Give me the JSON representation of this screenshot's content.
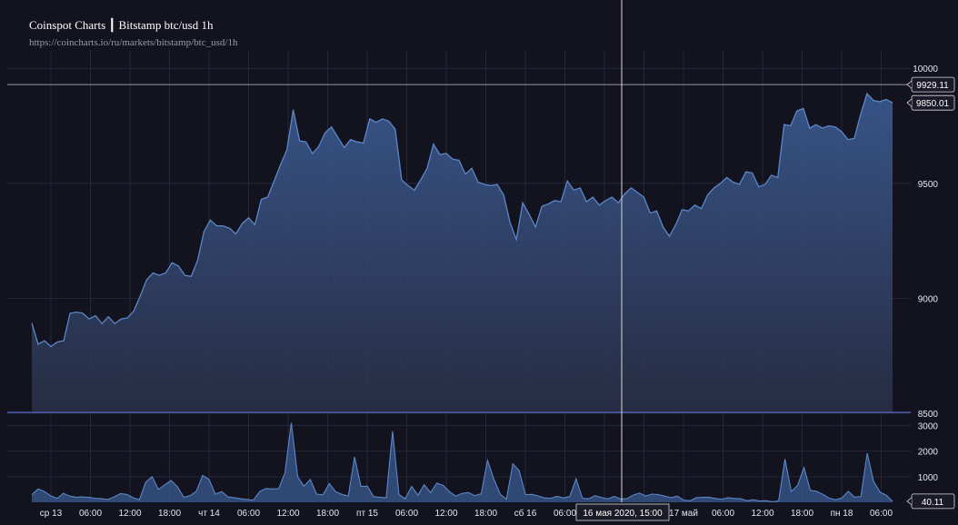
{
  "header": {
    "title": "Coinspot Charts ┃ Bitstamp  btc/usd  1h",
    "url": "https://coincharts.io/ru/markets/bitstamp/btc_usd/1h"
  },
  "chart_data": [
    {
      "type": "area",
      "title": "Bitstamp btc/usd 1h",
      "ylabel": "",
      "ylim": [
        8500,
        10060
      ],
      "yticks": [
        10000,
        9500,
        9000,
        8500
      ],
      "grid": true,
      "x_tick_labels": [
        "ср 13",
        "06:00",
        "12:00",
        "18:00",
        "чт 14",
        "06:00",
        "12:00",
        "18:00",
        "пт 15",
        "06:00",
        "12:00",
        "18:00",
        "сб 16",
        "06:00",
        "12:00",
        "18:00",
        "17 май",
        "06:00",
        "12:00",
        "18:00",
        "пн 18",
        "06:00"
      ],
      "values": [
        8892,
        8800,
        8815,
        8790,
        8810,
        8815,
        8935,
        8940,
        8935,
        8910,
        8925,
        8890,
        8920,
        8890,
        8910,
        8915,
        8945,
        9010,
        9080,
        9110,
        9100,
        9110,
        9155,
        9140,
        9100,
        9095,
        9165,
        9290,
        9340,
        9315,
        9315,
        9305,
        9280,
        9325,
        9350,
        9320,
        9430,
        9440,
        9510,
        9580,
        9645,
        9820,
        9685,
        9680,
        9630,
        9660,
        9720,
        9745,
        9700,
        9655,
        9690,
        9680,
        9675,
        9780,
        9765,
        9780,
        9770,
        9735,
        9515,
        9490,
        9470,
        9515,
        9565,
        9670,
        9625,
        9630,
        9605,
        9600,
        9540,
        9565,
        9505,
        9495,
        9490,
        9495,
        9450,
        9330,
        9255,
        9415,
        9365,
        9310,
        9400,
        9410,
        9425,
        9420,
        9510,
        9470,
        9480,
        9420,
        9440,
        9405,
        9425,
        9440,
        9415,
        9455,
        9480,
        9460,
        9440,
        9370,
        9380,
        9310,
        9270,
        9320,
        9385,
        9380,
        9405,
        9390,
        9450,
        9480,
        9500,
        9525,
        9505,
        9495,
        9550,
        9545,
        9485,
        9495,
        9535,
        9525,
        9755,
        9750,
        9815,
        9825,
        9740,
        9755,
        9740,
        9750,
        9745,
        9725,
        9690,
        9695,
        9800,
        9890,
        9860,
        9855,
        9865,
        9850
      ],
      "current_price": "9929.11",
      "last_price": "9850.01",
      "crosshair_label": "16 мая 2020, 15:00",
      "colors": {
        "line": "#5b87c7",
        "fill_top": "#3d5f99",
        "fill_bottom": "#2a3048",
        "crosshair": "#d8d8d8"
      }
    },
    {
      "type": "area",
      "title": "volume",
      "ylim": [
        0,
        3300
      ],
      "yticks": [
        3000,
        2000,
        1000
      ],
      "values": [
        300,
        520,
        420,
        250,
        150,
        350,
        240,
        200,
        210,
        190,
        160,
        140,
        110,
        210,
        340,
        310,
        180,
        100,
        780,
        1000,
        500,
        680,
        850,
        610,
        200,
        260,
        430,
        1050,
        890,
        320,
        420,
        210,
        180,
        140,
        110,
        80,
        420,
        540,
        520,
        530,
        1150,
        3100,
        1000,
        630,
        890,
        320,
        290,
        730,
        420,
        310,
        240,
        1770,
        620,
        630,
        220,
        200,
        180,
        2780,
        300,
        140,
        620,
        280,
        690,
        380,
        750,
        660,
        410,
        240,
        350,
        380,
        260,
        330,
        1640,
        910,
        320,
        120,
        1500,
        1240,
        300,
        310,
        250,
        170,
        160,
        230,
        170,
        230,
        920,
        160,
        140,
        260,
        190,
        130,
        230,
        130,
        140,
        280,
        360,
        250,
        320,
        300,
        240,
        180,
        240,
        80,
        60,
        180,
        190,
        200,
        150,
        120,
        180,
        150,
        140,
        60,
        100,
        50,
        60,
        20,
        50,
        1690,
        420,
        660,
        1360,
        470,
        430,
        310,
        160,
        100,
        170,
        430,
        200,
        230,
        1920,
        820,
        400,
        280,
        40
      ],
      "last_label": "40.11"
    }
  ]
}
